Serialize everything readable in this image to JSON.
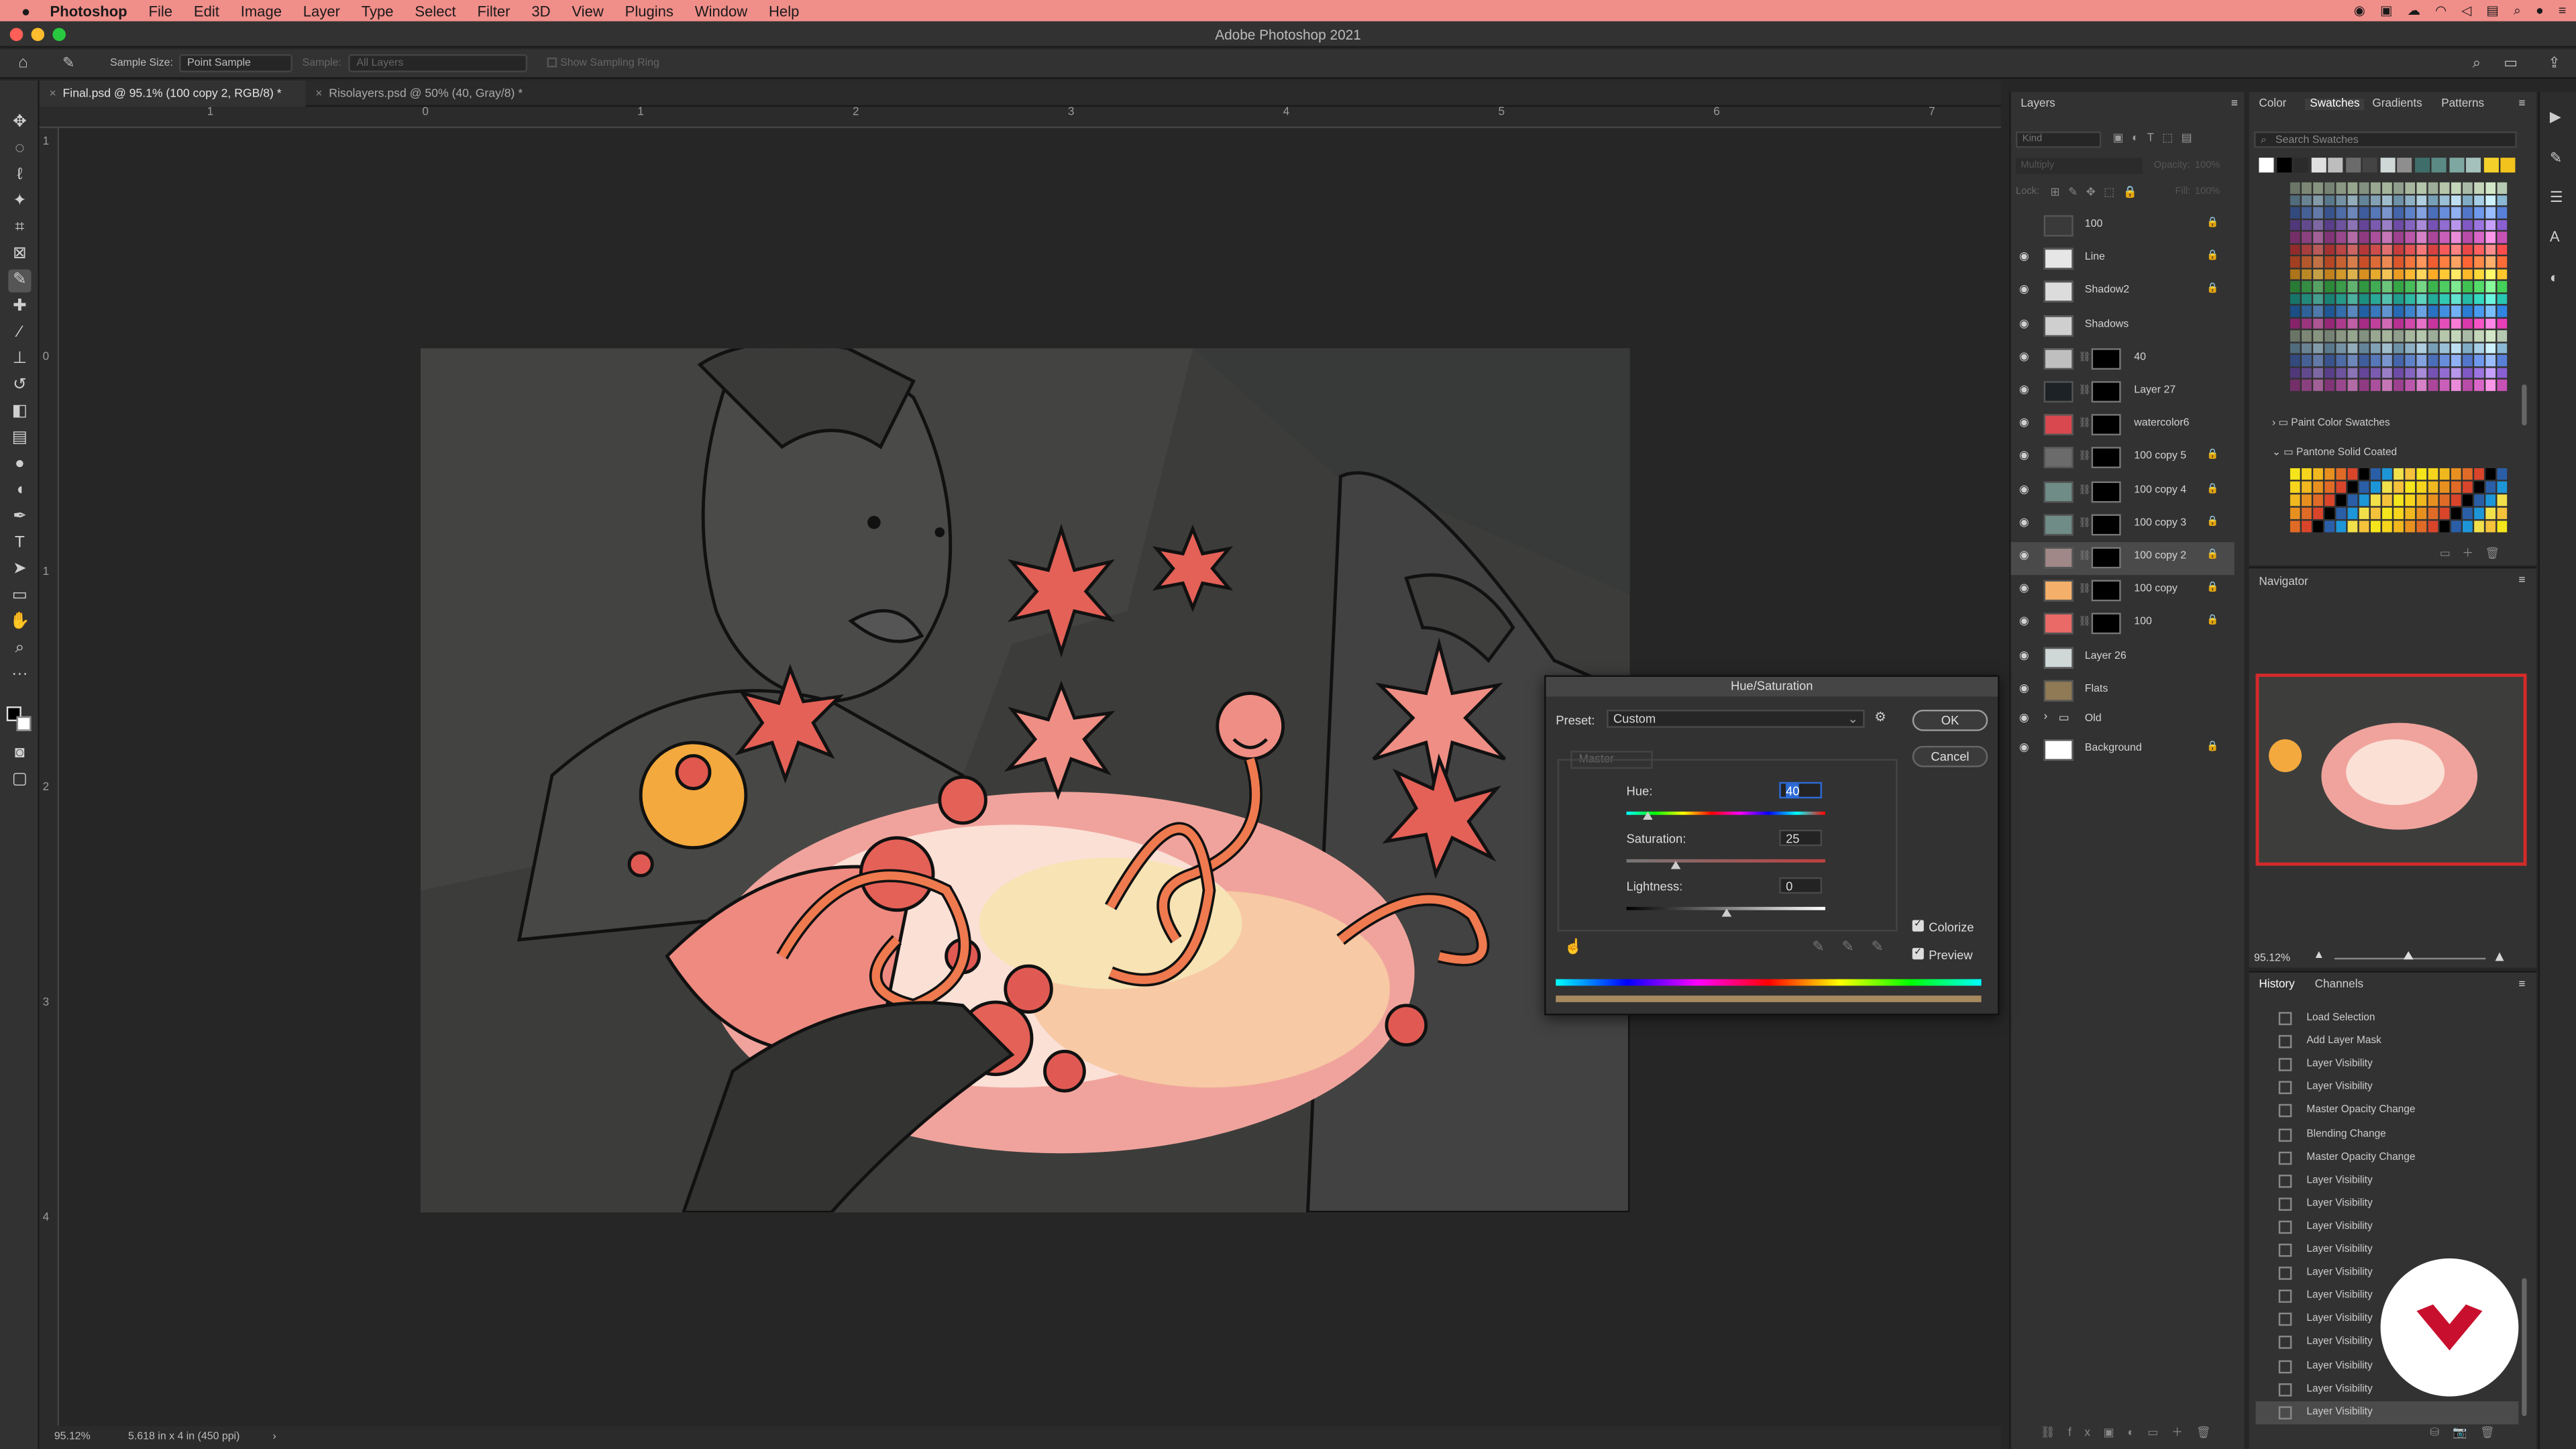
{
  "menubar": {
    "app": "Photoshop",
    "items": [
      "File",
      "Edit",
      "Image",
      "Layer",
      "Type",
      "Select",
      "Filter",
      "3D",
      "View",
      "Plugins",
      "Window",
      "Help"
    ]
  },
  "window": {
    "title": "Adobe Photoshop 2021"
  },
  "options": {
    "sample_size_label": "Sample Size:",
    "sample_size_value": "Point Sample",
    "sample_label": "Sample:",
    "sample_value": "All Layers",
    "sampling_ring": "Show Sampling Ring"
  },
  "tabs": [
    {
      "label": "Final.psd @ 95.1% (100 copy 2, RGB/8) *"
    },
    {
      "label": "Risolayers.psd @ 50% (40, Gray/8) *"
    }
  ],
  "ruler": {
    "h": [
      "1",
      "0",
      "1",
      "2",
      "3",
      "4",
      "5",
      "6",
      "7"
    ],
    "v": [
      "1",
      "0",
      "1",
      "2",
      "3",
      "4"
    ]
  },
  "status": {
    "zoom": "95.12%",
    "doc": "5.618 in x 4 in (450 ppi)"
  },
  "layers_panel": {
    "title": "Layers",
    "kind_placeholder": "Kind",
    "blend": "Multiply",
    "opacity_label": "Opacity:",
    "opacity_value": "100%",
    "lock_label": "Lock:",
    "fill_label": "Fill:",
    "fill_value": "100%",
    "layers": [
      {
        "name": "100",
        "locked": true,
        "visible": false,
        "mask": false,
        "thumb": "#3a3a3a"
      },
      {
        "name": "Line",
        "locked": true,
        "visible": true,
        "mask": false,
        "thumb": "#e6e6e6"
      },
      {
        "name": "Shadow2",
        "locked": true,
        "visible": true,
        "mask": false,
        "thumb": "#dcdcdc"
      },
      {
        "name": "Shadows",
        "locked": false,
        "visible": true,
        "mask": false,
        "thumb": "#cfcfcf"
      },
      {
        "name": "40",
        "locked": false,
        "visible": true,
        "mask": true,
        "thumb": "#bfbfbf"
      },
      {
        "name": "Layer 27",
        "locked": false,
        "visible": true,
        "mask": true,
        "thumb": "#1c2226"
      },
      {
        "name": "watercolor6",
        "locked": false,
        "visible": true,
        "mask": true,
        "thumb": "#d9484e"
      },
      {
        "name": "100 copy 5",
        "locked": true,
        "visible": true,
        "mask": true,
        "thumb": "#6b6b6b"
      },
      {
        "name": "100 copy 4",
        "locked": true,
        "visible": true,
        "mask": true,
        "thumb": "#6f8c86"
      },
      {
        "name": "100 copy 3",
        "locked": true,
        "visible": true,
        "mask": true,
        "thumb": "#6f8c86"
      },
      {
        "name": "100 copy 2",
        "locked": true,
        "visible": true,
        "mask": true,
        "thumb": "#a08888"
      },
      {
        "name": "100 copy",
        "locked": true,
        "visible": true,
        "mask": true,
        "thumb": "#f4b06a"
      },
      {
        "name": "100",
        "locked": true,
        "visible": true,
        "mask": true,
        "thumb": "#e96a66"
      },
      {
        "name": "Layer 26",
        "locked": false,
        "visible": true,
        "mask": false,
        "thumb": "#cfd7d7"
      },
      {
        "name": "Flats",
        "locked": false,
        "visible": true,
        "mask": false,
        "thumb": "#8f7a55"
      },
      {
        "name": "Old",
        "locked": false,
        "visible": true,
        "mask": false,
        "thumb": "",
        "group": true
      },
      {
        "name": "Background",
        "locked": true,
        "visible": true,
        "mask": false,
        "thumb": "#ffffff"
      }
    ]
  },
  "swatches_panel": {
    "tabs": [
      "Color",
      "Swatches",
      "Gradients",
      "Patterns"
    ],
    "search_placeholder": "Search Swatches",
    "groups": [
      "Paint Color Swatches",
      "Pantone Solid Coated"
    ]
  },
  "navigator": {
    "title": "Navigator",
    "zoom": "95.12%"
  },
  "history_panel": {
    "tabs": [
      "History",
      "Channels"
    ],
    "items": [
      "Load Selection",
      "Add Layer Mask",
      "Layer Visibility",
      "Layer Visibility",
      "Master Opacity Change",
      "Blending Change",
      "Master Opacity Change",
      "Layer Visibility",
      "Layer Visibility",
      "Layer Visibility",
      "Layer Visibility",
      "Layer Visibility",
      "Layer Visibility",
      "Layer Visibility",
      "Layer Visibility",
      "Layer Visibility",
      "Layer Visibility",
      "Layer Visibility"
    ]
  },
  "dialog": {
    "title": "Hue/Saturation",
    "preset_label": "Preset:",
    "preset_value": "Custom",
    "ok": "OK",
    "cancel": "Cancel",
    "channel": "Master",
    "hue_label": "Hue:",
    "hue_value": "40",
    "saturation_label": "Saturation:",
    "saturation_value": "25",
    "lightness_label": "Lightness:",
    "lightness_value": "0",
    "colorize_label": "Colorize",
    "preview_label": "Preview",
    "colorize": true,
    "preview": true,
    "hue_fraction": 0.11,
    "saturation_fraction": 0.25,
    "lightness_fraction": 0.5
  },
  "colors": {
    "menubar": "#f08e8a",
    "accent": "#2d6bd6"
  }
}
